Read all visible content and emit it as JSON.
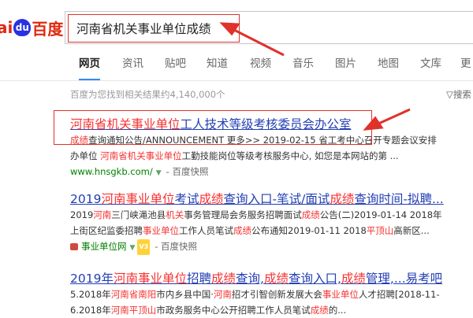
{
  "logo": {
    "part1": "ai",
    "paw": "du",
    "part2": "百度"
  },
  "search": {
    "value": "河南省机关事业单位成绩"
  },
  "tabs": [
    "网页",
    "资讯",
    "贴吧",
    "知道",
    "视频",
    "音乐",
    "图片",
    "地图",
    "文库",
    "更"
  ],
  "meta": {
    "result_count": "百度为您找到相关结果约4,140,000个",
    "tool_label": "搜索"
  },
  "results": [
    {
      "title_hl": "河南省机关事业单位",
      "title_rest": "工人技术等级考核委员会办公室",
      "abs1_hl": "成绩",
      "abs1_rest": "查询通知公告/ANNOUNCEMENT 更多>> 2019-02-15 省工考中心召开专题会议安排",
      "abs2_pre": "办单位 ",
      "abs2_hl": "河南省机关事业单位",
      "abs2_rest": "工勤技能岗位等级考核服务中心, 如您是本网站的第 ...",
      "url": "www.hnsgkb.com/",
      "snapshot": "百度快照"
    },
    {
      "title": "2019河南事业单位考试成绩查询入口-笔试/面试成绩查询时间-拟聘...",
      "abs1": "2019河南三门峡渑池县机关事务管理局会务服务招聘面试成绩公告(二)2019-01-14 2018年",
      "abs2": "上街区纪监委招聘事业单位工作人员笔试成绩公布通知2019-01-11 2018平顶山高新区...",
      "site": "事业单位网",
      "level": "V3",
      "snapshot": "百度快照"
    },
    {
      "title": "2019年河南事业单位招聘成绩查询,成绩查询入口,成绩管理,...易考吧",
      "abs1": "5.2018年河南省南阳市内乡县中国·河南招才引智创新发展大会事业单位人才招聘[2018-11-",
      "abs2": "6.2018年河南平顶山市政务服务中心公开招聘工作人员笔试成绩的..."
    }
  ]
}
